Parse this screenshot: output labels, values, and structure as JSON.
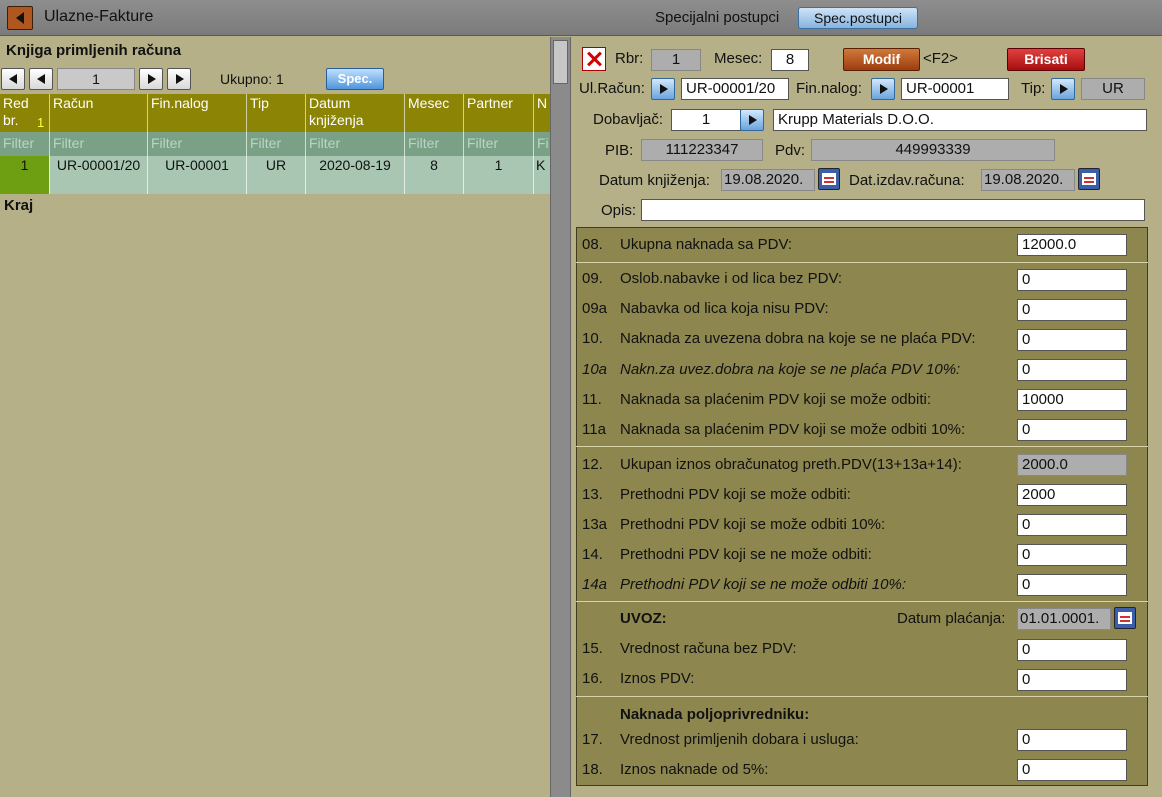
{
  "topbar": {
    "title": "Ulazne-Fakture",
    "spec_label": "Specijalni postupci",
    "spec_button": "Spec.postupci"
  },
  "left": {
    "title": "Knjiga primljenih računa",
    "page": "1",
    "total": "Ukupno: 1",
    "spec_button": "Spec.",
    "columns": [
      "Red br.",
      "Račun",
      "Fin.nalog",
      "Tip",
      "Datum knjiženja",
      "Mesec",
      "Partner",
      "N"
    ],
    "sort_indicator": "1",
    "filter_placeholder": "Filter",
    "filter_last": "Fi",
    "row": {
      "red_br": "1",
      "racun": "UR-00001/20",
      "fin_nalog": "UR-00001",
      "tip": "UR",
      "datum": "2020-08-19",
      "mesec": "8",
      "partner": "1",
      "n": "K"
    },
    "end_label": "Kraj"
  },
  "form": {
    "rbr_label": "Rbr:",
    "rbr_value": "1",
    "mesec_label": "Mesec:",
    "mesec_value": "8",
    "modif_button": "Modif",
    "modif_shortcut": "<F2>",
    "brisati_button": "Brisati",
    "ulracun_label": "Ul.Račun:",
    "ulracun_value": "UR-00001/20",
    "finnalog_label": "Fin.nalog:",
    "finnalog_value": "UR-00001",
    "tip_label": "Tip:",
    "tip_value": "UR",
    "dobavljac_label": "Dobavljač:",
    "dobavljac_id": "1",
    "dobavljac_name": "Krupp Materials D.O.O.",
    "pib_label": "PIB:",
    "pib_value": "111223347",
    "pdv_label": "Pdv:",
    "pdv_value": "449993339",
    "datum_knj_label": "Datum knjiženja:",
    "datum_knj_value": "19.08.2020.",
    "dat_izdav_label": "Dat.izdav.računa:",
    "dat_izdav_value": "19.08.2020.",
    "opis_label": "Opis:",
    "opis_value": ""
  },
  "items": {
    "r08": {
      "num": "08.",
      "label": "Ukupna naknada sa PDV:",
      "value": "12000.0"
    },
    "r09": {
      "num": "09.",
      "label": "Oslob.nabavke i od lica bez PDV:",
      "value": "0"
    },
    "r09a": {
      "num": "09a",
      "label": "Nabavka od lica koja nisu PDV:",
      "value": "0"
    },
    "r10": {
      "num": "10.",
      "label": "Naknada za uvezena dobra na koje se ne plaća PDV:",
      "value": "0"
    },
    "r10a": {
      "num": "10a",
      "label": "Nakn.za uvez.dobra na koje se ne plaća PDV 10%:",
      "value": "0"
    },
    "r11": {
      "num": "11.",
      "label": "Naknada sa plaćenim PDV koji se može odbiti:",
      "value": "10000"
    },
    "r11a": {
      "num": "11a",
      "label": "Naknada sa plaćenim PDV koji se može odbiti 10%:",
      "value": "0"
    },
    "r12": {
      "num": "12.",
      "label": "Ukupan iznos obračunatog preth.PDV(13+13a+14):",
      "value": "2000.0"
    },
    "r13": {
      "num": "13.",
      "label": "Prethodni PDV koji se može odbiti:",
      "value": "2000"
    },
    "r13a": {
      "num": "13a",
      "label": "Prethodni PDV koji se može odbiti 10%:",
      "value": "0"
    },
    "r14": {
      "num": "14.",
      "label": "Prethodni PDV koji se ne može odbiti:",
      "value": "0"
    },
    "r14a": {
      "num": "14a",
      "label": "Prethodni PDV koji se ne može odbiti 10%:",
      "value": "0"
    },
    "uvoz_label": "UVOZ:",
    "datum_placanja_label": "Datum plaćanja:",
    "datum_placanja_value": "01.01.0001.",
    "r15": {
      "num": "15.",
      "label": "Vrednost računa bez PDV:",
      "value": "0"
    },
    "r16": {
      "num": "16.",
      "label": "Iznos PDV:",
      "value": "0"
    },
    "poljo_label": "Naknada poljoprivredniku:",
    "r17": {
      "num": "17.",
      "label": "Vrednost primljenih dobara i usluga:",
      "value": "0"
    },
    "r18": {
      "num": "18.",
      "label": "Iznos naknade od 5%:",
      "value": "0"
    }
  }
}
